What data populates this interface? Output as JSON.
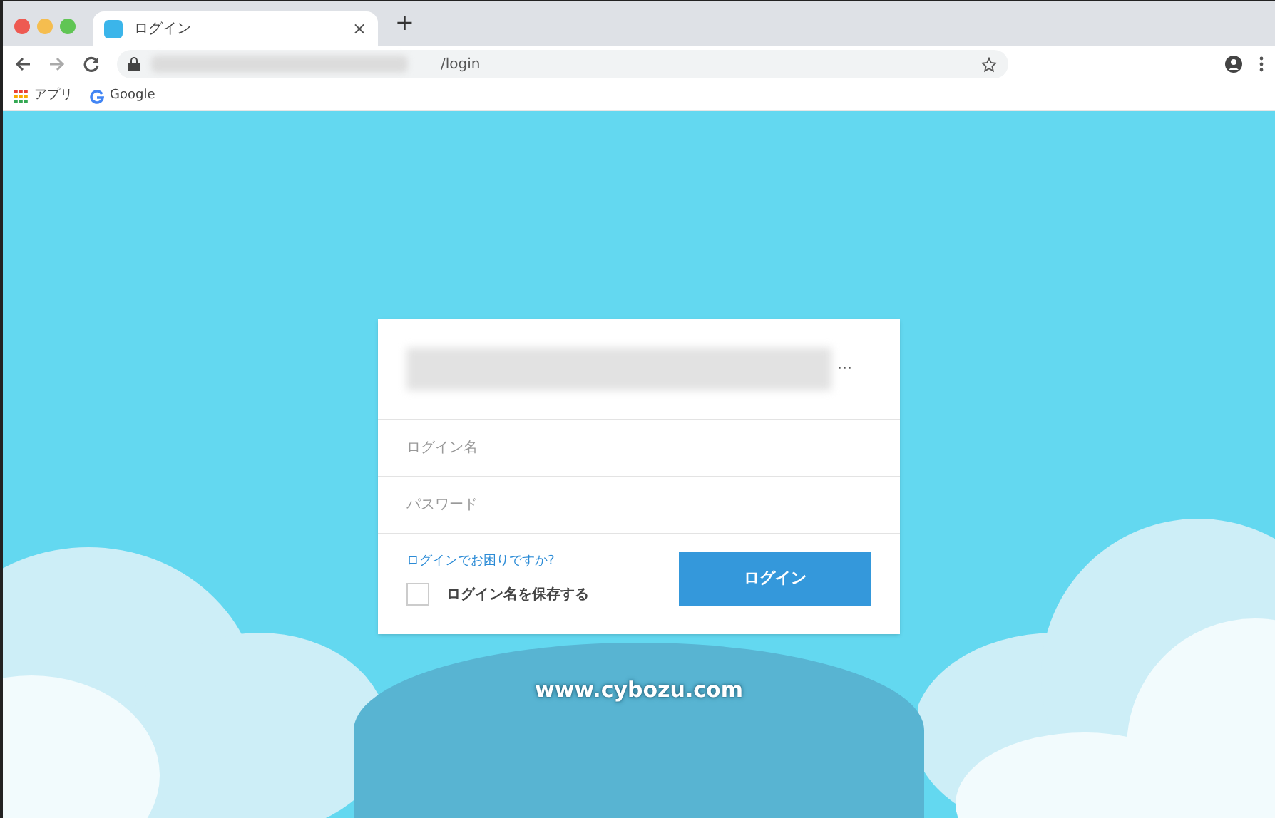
{
  "browser": {
    "tab_title": "ログイン",
    "close": "×",
    "new_tab": "+",
    "url": "/login",
    "bookmarks": [
      {
        "kind": "apps",
        "label": "アプリ"
      },
      {
        "kind": "google",
        "label": "Google"
      }
    ]
  },
  "login": {
    "title_suffix": "···",
    "fields": [
      {
        "placeholder": "ログイン名"
      },
      {
        "placeholder": "パスワード"
      }
    ],
    "help_link": "ログインでお困りですか?",
    "remember": {
      "label": "ログイン名を保存する",
      "checked": false
    },
    "submit": "ログイン"
  },
  "footer": "www.cybozu.com"
}
